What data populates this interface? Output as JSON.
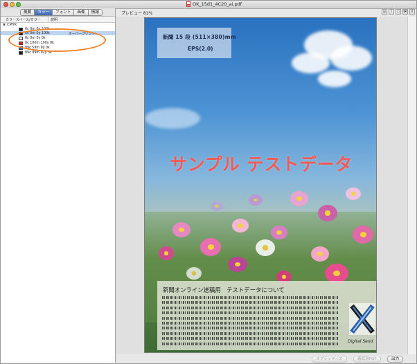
{
  "window": {
    "title": "OK_15d1_4C20_ai.pdf"
  },
  "sidebar": {
    "tabs": [
      {
        "label": "概要",
        "active": false
      },
      {
        "label": "カラー",
        "active": true
      },
      {
        "label": "フォント",
        "active": false
      },
      {
        "label": "画像",
        "active": false
      },
      {
        "label": "情報",
        "active": false
      }
    ],
    "columns": {
      "name": "カラースペース/カラー",
      "comment": "説明"
    },
    "root": "CMYK",
    "swatches": [
      {
        "label": "0c 0m 0y 100k",
        "note": "",
        "color": "#111111",
        "selected": false
      },
      {
        "label": "0c 0m 0y 100k",
        "note": "オーバープリント",
        "color": "#000000",
        "selected": true
      },
      {
        "label": "0c 0m 0y 0k",
        "note": "",
        "color": "#ffffff",
        "selected": false
      },
      {
        "label": "0c 100m 100y 0k",
        "note": "",
        "color": "#e01f26",
        "selected": false
      },
      {
        "label": "89c 59m 9y 0k",
        "note": "",
        "color": "#2163a8",
        "selected": false
      },
      {
        "label": "89c 99m 92y 3k",
        "note": "",
        "color": "#2b1a1e",
        "selected": false
      }
    ]
  },
  "preview": {
    "label": "プレビュー 81%"
  },
  "toolbar": {
    "icons": [
      "zoom-icon",
      "text-cursor-icon",
      "copy-icon",
      "pointer-icon",
      "magnifier-icon"
    ]
  },
  "document": {
    "info_line1": "新聞 15 段 (511×380)mm",
    "info_line2": "EPS(2.0)",
    "sample_text": "サンプル テストデータ",
    "panel_title": "新聞オンライン送稿用　テストデータについて",
    "logo_caption": "Digital Send"
  },
  "buttons": {
    "optimize": "オプティマイズ",
    "proof": "確認用PDF",
    "output": "出力"
  },
  "colors": {
    "accent": "#3e67ae",
    "highlight_oval": "#f0822a",
    "sample_text": "#f05a57"
  }
}
